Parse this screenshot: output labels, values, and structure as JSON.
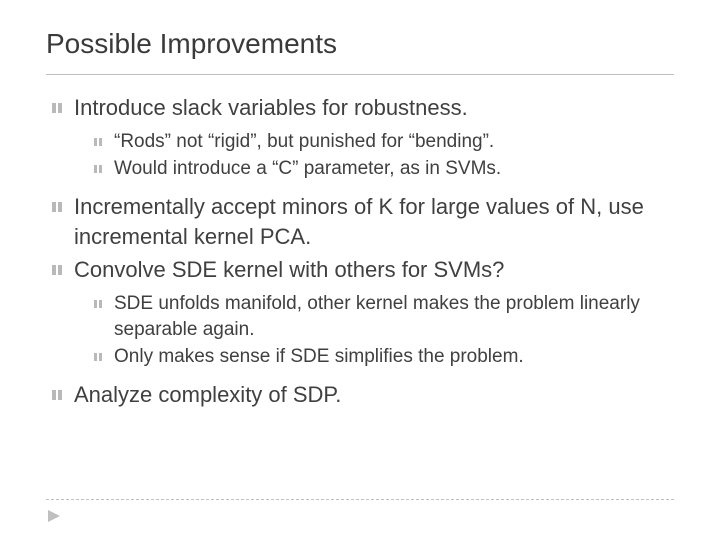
{
  "title": "Possible Improvements",
  "bullets": {
    "b1": "Introduce slack variables for robustness.",
    "b1a": "“Rods” not “rigid”, but punished for “bending”.",
    "b1b": "Would introduce a “C” parameter, as in SVMs.",
    "b2": "Incrementally accept minors of K for large values of N, use incremental kernel PCA.",
    "b3": "Convolve SDE kernel with others for SVMs?",
    "b3a": "SDE unfolds manifold, other kernel makes the problem linearly separable again.",
    "b3b": "Only makes sense if SDE simplifies the problem.",
    "b4": "Analyze complexity of SDP."
  }
}
